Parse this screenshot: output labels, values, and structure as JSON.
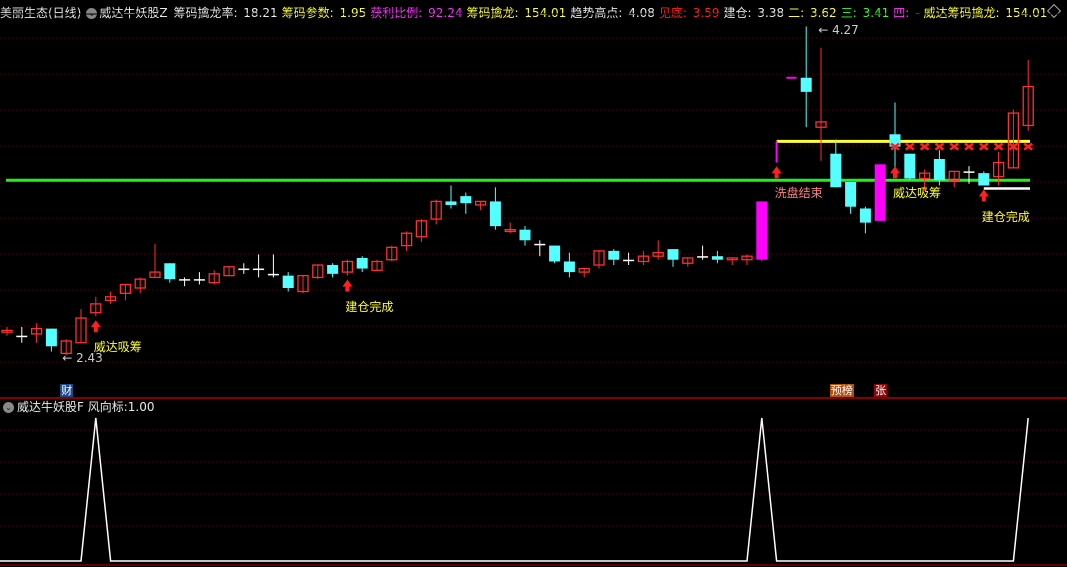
{
  "header": {
    "stock": "美丽生态(日线)",
    "indicator": "威达牛妖股Z",
    "items": [
      {
        "label": "筹码擒龙率:",
        "value": "18.21",
        "color": "#e8e8e8"
      },
      {
        "label": "筹码参数:",
        "value": "1.95",
        "color": "#ffff33"
      },
      {
        "label": "获利比例:",
        "value": "92.24",
        "color": "#ff33ff"
      },
      {
        "label": "筹码擒龙:",
        "value": "154.01",
        "color": "#ffff33"
      },
      {
        "label": "趋势高点:",
        "value": "4.08",
        "color": "#e8e8e8"
      },
      {
        "label": "见底:",
        "value": "3.59",
        "color": "#ff2020"
      },
      {
        "label": "建仓:",
        "value": "3.38",
        "color": "#e8e8e8"
      },
      {
        "label": "二:",
        "value": "3.62",
        "color": "#ffff33"
      },
      {
        "label": "三:",
        "value": "3.41",
        "color": "#33ff33"
      },
      {
        "label": "四:",
        "value": "-",
        "color": "#ff33ff"
      },
      {
        "label": "威达筹码擒龙:",
        "value": "154.01",
        "color": "#ffff33"
      }
    ]
  },
  "sub_panel": {
    "indicator": "威达牛妖股F",
    "label": "风向标:",
    "value": "1.00"
  },
  "annotations": {
    "high": "4.27",
    "low": "2.43"
  },
  "signals": [
    {
      "candle": 7,
      "text": "威达吸筹",
      "color": "#ffff33"
    },
    {
      "candle": 24,
      "text": "建仓完成",
      "color": "#ffff33"
    },
    {
      "candle": 53,
      "text": "洗盘结束",
      "color": "#ff8080"
    },
    {
      "candle": 61,
      "text": "威达吸筹",
      "color": "#ffff33"
    },
    {
      "candle": 67,
      "text": "建仓完成",
      "color": "#ffff33"
    }
  ],
  "tags": [
    {
      "text": "财",
      "candle": 5,
      "color": "#1a4a8a"
    },
    {
      "text": "预榜",
      "candle": 57,
      "color": "#b05010"
    },
    {
      "text": "张",
      "candle": 60,
      "color": "#8a0a0a"
    }
  ],
  "lines": {
    "green": 3.42,
    "yellow": 3.64,
    "white": 3.39,
    "cross_level": 3.61
  },
  "colors": {
    "up": "#ff3030",
    "down": "#55ffff",
    "flat": "#ffffff",
    "special": "#ff00ff"
  },
  "chart_data": {
    "type": "candlestick",
    "ylim": [
      2.43,
      4.29
    ],
    "candles": [
      [
        2.56,
        2.59,
        2.54,
        2.57
      ],
      [
        2.54,
        2.59,
        2.5,
        2.54
      ],
      [
        2.55,
        2.61,
        2.5,
        2.58
      ],
      [
        2.58,
        2.58,
        2.45,
        2.48
      ],
      [
        2.44,
        2.52,
        2.43,
        2.51
      ],
      [
        2.5,
        2.69,
        2.5,
        2.64
      ],
      [
        2.67,
        2.76,
        2.65,
        2.72
      ],
      [
        2.74,
        2.79,
        2.72,
        2.76
      ],
      [
        2.78,
        2.83,
        2.74,
        2.83
      ],
      [
        2.81,
        2.87,
        2.78,
        2.86
      ],
      [
        2.87,
        3.06,
        2.87,
        2.9
      ],
      [
        2.95,
        2.95,
        2.84,
        2.86
      ],
      [
        2.86,
        2.87,
        2.82,
        2.86
      ],
      [
        2.86,
        2.9,
        2.83,
        2.86
      ],
      [
        2.84,
        2.91,
        2.83,
        2.89
      ],
      [
        2.88,
        2.93,
        2.88,
        2.93
      ],
      [
        2.92,
        2.95,
        2.89,
        2.92
      ],
      [
        2.92,
        3.0,
        2.87,
        2.92
      ],
      [
        2.89,
        3.0,
        2.87,
        2.89
      ],
      [
        2.88,
        2.9,
        2.79,
        2.81
      ],
      [
        2.79,
        2.88,
        2.78,
        2.88
      ],
      [
        2.87,
        2.94,
        2.86,
        2.94
      ],
      [
        2.94,
        2.95,
        2.87,
        2.89
      ],
      [
        2.9,
        2.97,
        2.88,
        2.96
      ],
      [
        2.98,
        2.99,
        2.9,
        2.92
      ],
      [
        2.91,
        2.97,
        2.91,
        2.96
      ],
      [
        2.97,
        3.05,
        2.96,
        3.04
      ],
      [
        3.05,
        3.13,
        3.02,
        3.12
      ],
      [
        3.1,
        3.2,
        3.07,
        3.19
      ],
      [
        3.2,
        3.31,
        3.17,
        3.3
      ],
      [
        3.3,
        3.39,
        3.26,
        3.28
      ],
      [
        3.33,
        3.35,
        3.23,
        3.29
      ],
      [
        3.28,
        3.3,
        3.25,
        3.3
      ],
      [
        3.3,
        3.38,
        3.14,
        3.16
      ],
      [
        3.13,
        3.18,
        3.12,
        3.14
      ],
      [
        3.14,
        3.16,
        3.05,
        3.08
      ],
      [
        3.06,
        3.08,
        2.99,
        3.06
      ],
      [
        3.05,
        3.05,
        2.95,
        2.96
      ],
      [
        2.96,
        3.01,
        2.87,
        2.9
      ],
      [
        2.9,
        2.92,
        2.87,
        2.92
      ],
      [
        2.94,
        3.02,
        2.92,
        3.02
      ],
      [
        3.02,
        3.03,
        2.94,
        2.97
      ],
      [
        2.97,
        3.01,
        2.94,
        2.97
      ],
      [
        2.96,
        3.02,
        2.94,
        2.99
      ],
      [
        2.99,
        3.08,
        2.97,
        3.01
      ],
      [
        3.03,
        3.03,
        2.93,
        2.97
      ],
      [
        2.95,
        2.98,
        2.93,
        2.98
      ],
      [
        2.99,
        3.05,
        2.97,
        2.99
      ],
      [
        2.99,
        3.02,
        2.95,
        2.97
      ],
      [
        2.97,
        2.98,
        2.94,
        2.98
      ],
      [
        2.97,
        3.0,
        2.94,
        2.99
      ],
      [
        2.97,
        3.3,
        2.96,
        3.3
      ],
      [
        3.52,
        3.64,
        3.52,
        3.64
      ],
      [
        4.0,
        4.0,
        4.0,
        4.0
      ],
      [
        4.0,
        4.29,
        3.72,
        3.92
      ],
      [
        3.72,
        4.17,
        3.53,
        3.75
      ],
      [
        3.57,
        3.65,
        3.38,
        3.38
      ],
      [
        3.41,
        3.41,
        3.23,
        3.27
      ],
      [
        3.26,
        3.27,
        3.12,
        3.18
      ],
      [
        3.19,
        3.51,
        3.19,
        3.51
      ],
      [
        3.68,
        3.86,
        3.49,
        3.61
      ],
      [
        3.57,
        3.57,
        3.42,
        3.43
      ],
      [
        3.43,
        3.48,
        3.36,
        3.46
      ],
      [
        3.54,
        3.59,
        3.39,
        3.42
      ],
      [
        3.42,
        3.47,
        3.38,
        3.47
      ],
      [
        3.47,
        3.5,
        3.4,
        3.47
      ],
      [
        3.46,
        3.47,
        3.39,
        3.39
      ],
      [
        3.44,
        3.58,
        3.39,
        3.52
      ],
      [
        3.49,
        3.82,
        3.49,
        3.8
      ],
      [
        3.73,
        4.1,
        3.7,
        3.95
      ]
    ],
    "special_candles": [
      52,
      53,
      54,
      60
    ],
    "cross_from_candle": 61,
    "sub_series": {
      "name": "风向标",
      "ones_at": [
        7,
        52,
        70
      ],
      "ylim": [
        0,
        1
      ]
    }
  }
}
